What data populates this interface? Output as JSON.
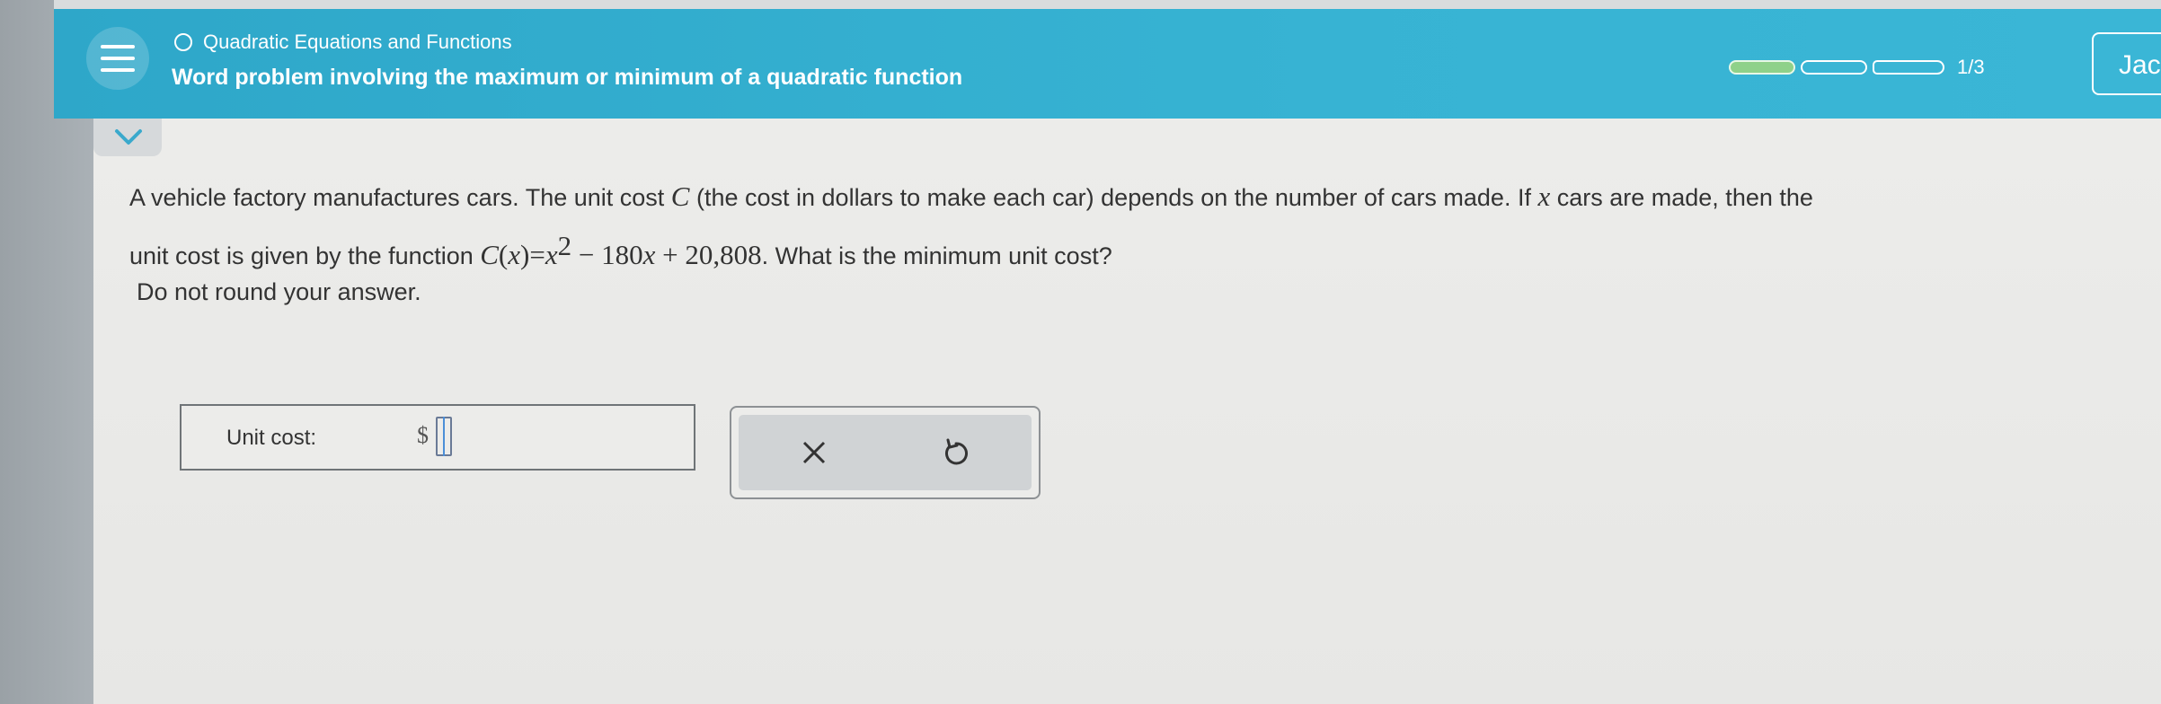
{
  "header": {
    "topic": "Quadratic Equations and Functions",
    "title": "Word problem involving the maximum or minimum of a quadratic function",
    "progress": {
      "current": 1,
      "total": 3,
      "label": "1/3"
    },
    "user_label": "Jac"
  },
  "problem": {
    "line1_text": "A vehicle factory manufactures cars. The unit cost ",
    "var_C": "C",
    "line1_text2": " (the cost in dollars to make each car) depends on the number of cars made. If ",
    "var_x": "x",
    "line1_text3": " cars are made, then the",
    "line2_text": "unit cost is given by the function ",
    "func_C": "C",
    "func_paren_open": "(",
    "func_x": "x",
    "func_paren_close": ")",
    "func_eq": "=",
    "func_x2": "x",
    "func_exp": "2",
    "func_rest": " − 180",
    "func_x3": "x",
    "func_const": " + 20,808",
    "line2_text2": ". What is the minimum unit cost?",
    "instruction": "Do not round your answer."
  },
  "answer": {
    "label": "Unit cost:",
    "currency": "$",
    "value": ""
  },
  "icons": {
    "menu": "hamburger-menu-icon",
    "topic": "circle-outline-icon",
    "collapse": "chevron-down-icon",
    "clear": "close-x-icon",
    "undo": "undo-icon"
  },
  "colors": {
    "header": "#37b3d3",
    "progress_fill": "#8fd18a",
    "content_bg": "#ececea",
    "text": "#333333"
  }
}
